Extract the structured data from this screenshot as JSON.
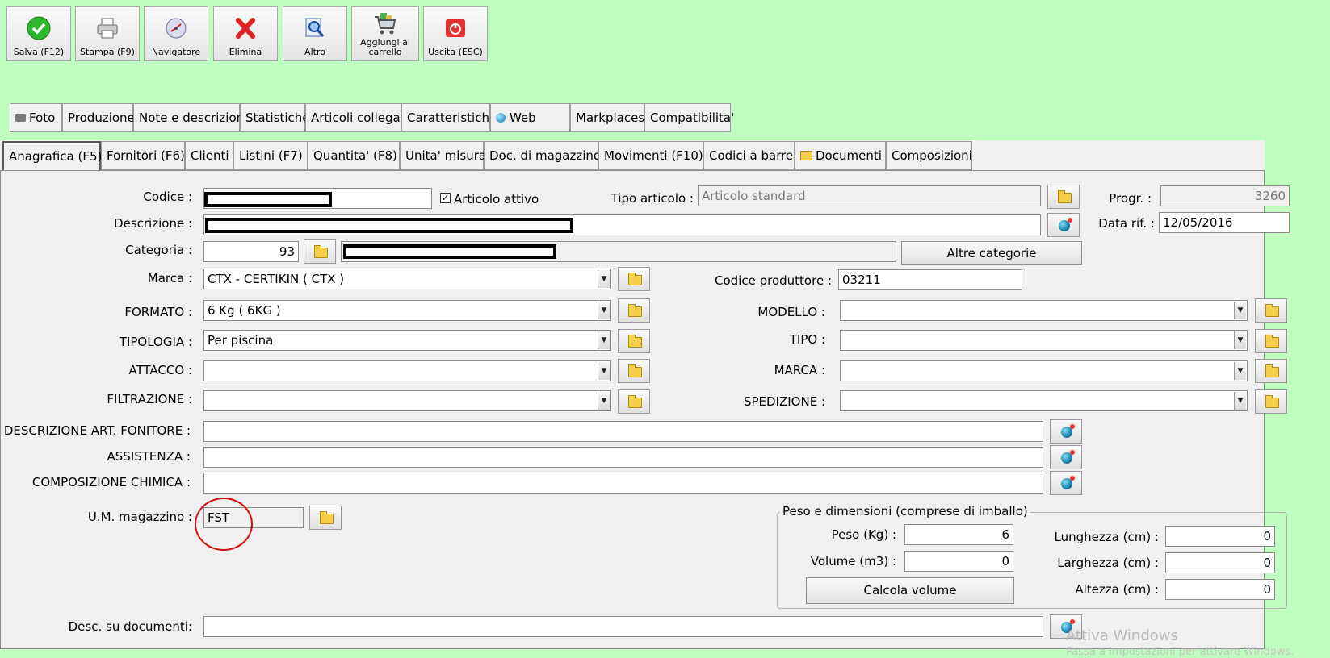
{
  "toolbar": {
    "salva": "Salva (F12)",
    "stampa": "Stampa (F9)",
    "navigatore": "Navigatore",
    "elimina": "Elimina",
    "altro": "Altro",
    "aggiungi_1": "Aggiungi al",
    "aggiungi_2": "carrello",
    "uscita": "Uscita (ESC)"
  },
  "tabs_top": [
    "Foto",
    "Produzione",
    "Note e descrizioni",
    "Statistiche",
    "Articoli collegati",
    "Caratteristiche",
    "Web",
    "Markplaces",
    "Compatibilita'"
  ],
  "tabs_bottom": [
    "Anagrafica (F5)",
    "Fornitori (F6)",
    "Clienti",
    "Listini (F7)",
    "Quantita' (F8)",
    "Unita' misura",
    "Doc. di magazzino",
    "Movimenti (F10)",
    "Codici a barre",
    "Documenti",
    "Composizioni"
  ],
  "form": {
    "codice_label": "Codice :",
    "articolo_attivo_label": "Articolo attivo",
    "tipo_articolo_label": "Tipo articolo :",
    "tipo_articolo_value": "Articolo standard",
    "progr_label": "Progr. :",
    "progr_value": "3260",
    "descrizione_label": "Descrizione :",
    "data_rif_label": "Data rif. :",
    "data_rif_value": "12/05/2016",
    "categoria_label": "Categoria :",
    "categoria_value": "93",
    "altre_categorie": "Altre categorie",
    "marca_label": "Marca :",
    "marca_value": "CTX - CERTIKIN ( CTX )",
    "codice_produttore_label": "Codice produttore :",
    "codice_produttore_value": "03211",
    "formato_label": "FORMATO :",
    "formato_value": "6 Kg ( 6KG )",
    "modello_label": "MODELLO :",
    "tipologia_label": "TIPOLOGIA :",
    "tipologia_value": "Per piscina",
    "tipo_label": "TIPO :",
    "attacco_label": "ATTACCO :",
    "marca2_label": "MARCA :",
    "filtrazione_label": "FILTRAZIONE :",
    "spedizione_label": "SPEDIZIONE :",
    "desc_art_fornitore_label": "DESCRIZIONE ART. FONITORE :",
    "assistenza_label": "ASSISTENZA :",
    "composizione_label": "COMPOSIZIONE CHIMICA :",
    "um_label": "U.M. magazzino :",
    "um_value": "FST",
    "peso_group": "Peso e dimensioni (comprese di imballo)",
    "peso_label": "Peso (Kg) :",
    "peso_value": "6",
    "volume_label": "Volume (m3) :",
    "volume_value": "0",
    "calcola_volume": "Calcola volume",
    "lunghezza_label": "Lunghezza (cm) :",
    "lunghezza_value": "0",
    "larghezza_label": "Larghezza (cm) :",
    "larghezza_value": "0",
    "altezza_label": "Altezza (cm) :",
    "altezza_value": "0",
    "desc_documenti_label": "Desc. su documenti:"
  },
  "watermark": {
    "line1": "Attiva Windows",
    "line2": "Passa a Impostazioni per attivare Windows."
  },
  "colors": {
    "background": "#c0fdc0",
    "panel": "#f0f0f0",
    "annotation_circle": "#d01010"
  }
}
